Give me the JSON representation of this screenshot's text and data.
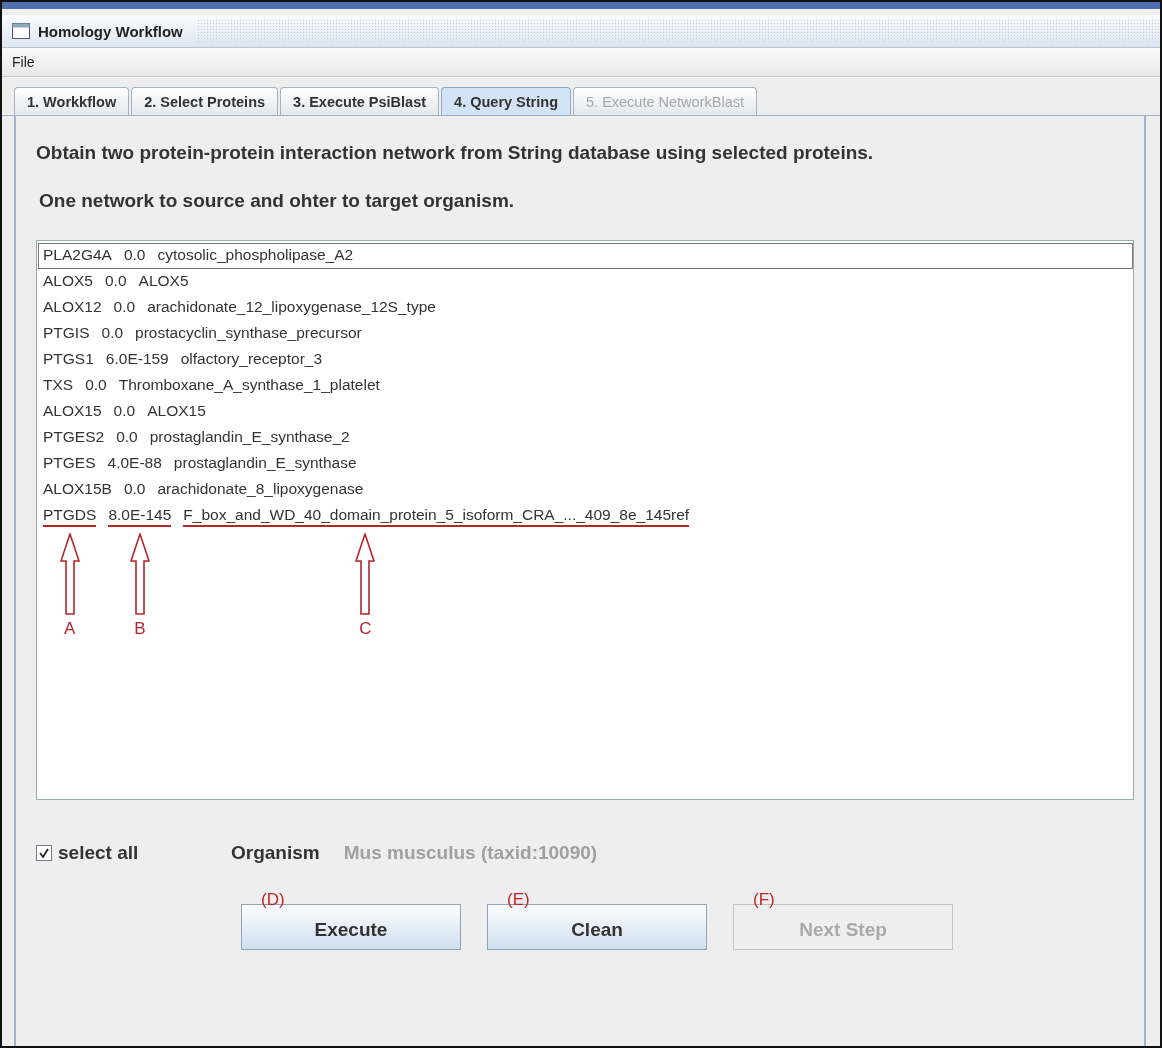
{
  "window": {
    "title": "Homology Workflow"
  },
  "menu": [
    "File"
  ],
  "tabs": [
    {
      "label": "1. Workkflow",
      "selected": false,
      "disabled": false
    },
    {
      "label": "2. Select Proteins",
      "selected": false,
      "disabled": false
    },
    {
      "label": "3. Execute PsiBlast",
      "selected": false,
      "disabled": false
    },
    {
      "label": "4. Query String",
      "selected": true,
      "disabled": false
    },
    {
      "label": "5. Execute NetworkBlast",
      "selected": false,
      "disabled": true
    }
  ],
  "instructions": [
    "Obtain two protein-protein interaction network from String database using  selected proteins.",
    "One network to source and ohter to target organism."
  ],
  "proteins": [
    {
      "gene": "PLA2G4A",
      "evalue": "0.0",
      "description": "cytosolic_phospholipase_A2",
      "selected": true
    },
    {
      "gene": "ALOX5",
      "evalue": "0.0",
      "description": "ALOX5",
      "selected": false
    },
    {
      "gene": "ALOX12",
      "evalue": "0.0",
      "description": "arachidonate_12_lipoxygenase_12S_type",
      "selected": false
    },
    {
      "gene": "PTGIS",
      "evalue": "0.0",
      "description": "prostacyclin_synthase_precursor",
      "selected": false
    },
    {
      "gene": "PTGS1",
      "evalue": "6.0E-159",
      "description": "olfactory_receptor_3",
      "selected": false
    },
    {
      "gene": "TXS",
      "evalue": "0.0",
      "description": "Thromboxane_A_synthase_1_platelet",
      "selected": false
    },
    {
      "gene": "ALOX15",
      "evalue": "0.0",
      "description": "ALOX15",
      "selected": false
    },
    {
      "gene": "PTGES2",
      "evalue": "0.0",
      "description": "prostaglandin_E_synthase_2",
      "selected": false
    },
    {
      "gene": "PTGES",
      "evalue": "4.0E-88",
      "description": "prostaglandin_E_synthase",
      "selected": false
    },
    {
      "gene": "ALOX15B",
      "evalue": "0.0",
      "description": "arachidonate_8_lipoxygenase",
      "selected": false
    },
    {
      "gene": "PTGDS",
      "evalue": "8.0E-145",
      "description": "F_box_and_WD_40_domain_protein_5_isoform_CRA_..._409_8e_145ref",
      "selected": false,
      "callouts": [
        "A",
        "B",
        "C"
      ]
    }
  ],
  "select_all": {
    "label": "select all",
    "checked": true
  },
  "organism": {
    "label": "Organism",
    "value": "Mus musculus (taxid:10090)"
  },
  "buttons": [
    {
      "label": "Execute",
      "callout": "(D)",
      "disabled": false
    },
    {
      "label": "Clean",
      "callout": "(E)",
      "disabled": false
    },
    {
      "label": "Next Step",
      "callout": "(F)",
      "disabled": true
    }
  ]
}
